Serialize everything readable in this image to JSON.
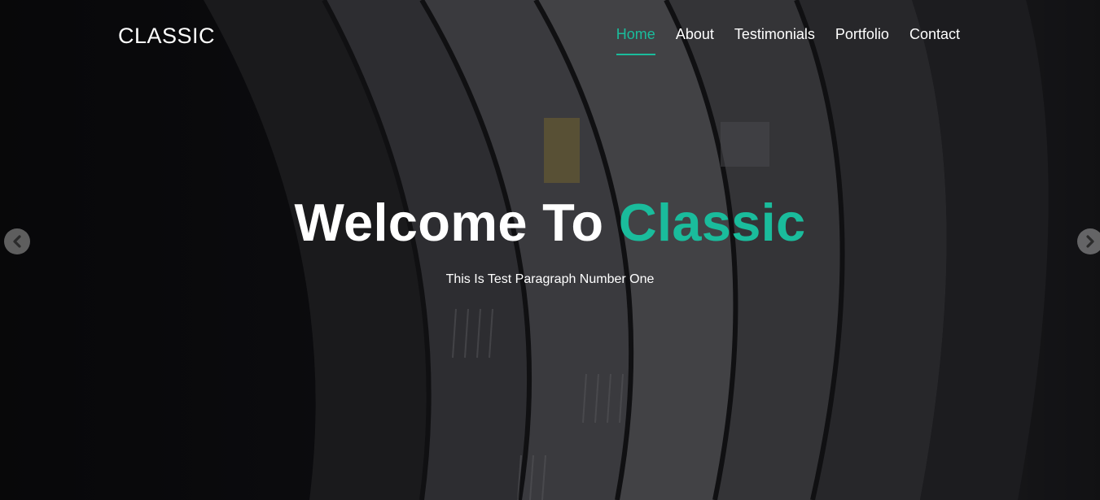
{
  "brand": {
    "name": "CLASSIC"
  },
  "nav": {
    "items": [
      {
        "label": "Home",
        "active": true
      },
      {
        "label": "About"
      },
      {
        "label": "Testimonials"
      },
      {
        "label": "Portfolio"
      },
      {
        "label": "Contact"
      }
    ]
  },
  "slide": {
    "title_prefix": "Welcome To",
    "title_highlight": "Classic",
    "paragraph": "This Is Test Paragraph Number One"
  },
  "carousel": {
    "prev_icon": "chevron-left-icon",
    "next_icon": "chevron-right-icon"
  },
  "colors": {
    "accent": "#1abc9c",
    "text": "#ffffff",
    "overlay": "#000000"
  }
}
